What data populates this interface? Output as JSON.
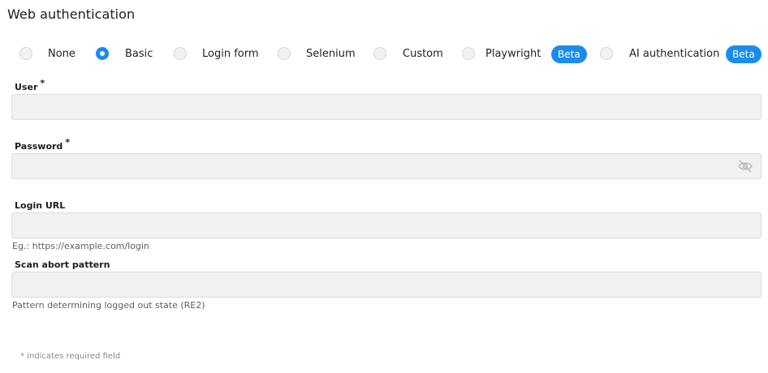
{
  "page": {
    "title": "Web authentication"
  },
  "auth_methods": {
    "selected": "Basic",
    "options": [
      {
        "label": "None"
      },
      {
        "label": "Basic"
      },
      {
        "label": "Login form"
      },
      {
        "label": "Selenium"
      },
      {
        "label": "Custom"
      },
      {
        "label": "Playwright",
        "badge": "Beta"
      },
      {
        "label": "AI authentication",
        "badge": "Beta"
      }
    ]
  },
  "fields": {
    "user": {
      "label": "User",
      "required_mark": "*",
      "value": ""
    },
    "password": {
      "label": "Password",
      "required_mark": "*",
      "value": "",
      "toggle_icon": "eye-off-icon"
    },
    "login_url": {
      "label": "Login URL",
      "value": "",
      "helper": "Eg.: https://example.com/login"
    },
    "scan_abort_pattern": {
      "label": "Scan abort pattern",
      "value": "",
      "helper": "Pattern determining logged out state (RE2)"
    }
  },
  "footnote": "* indicates required field",
  "colors": {
    "accent": "#1a8cf0",
    "input_background": "#f1f1f1",
    "input_border": "#dcdcdc"
  }
}
